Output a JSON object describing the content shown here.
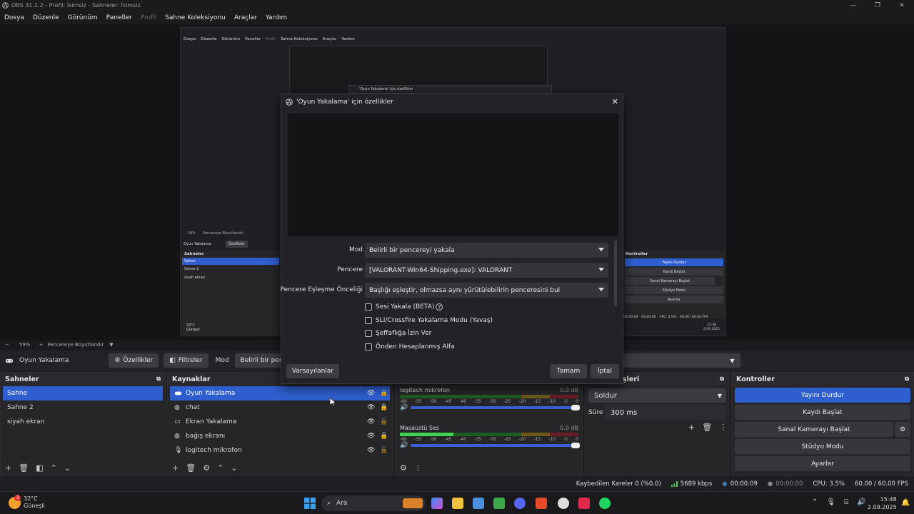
{
  "window": {
    "title": "OBS 31.1.2 - Profil: İsimsiz - Sahneler: İsimsiz"
  },
  "menu": {
    "items": [
      "Dosya",
      "Düzenle",
      "Görünüm",
      "Paneller",
      "Profil",
      "Sahne Koleksiyonu",
      "Araçlar",
      "Yardım"
    ],
    "disabled": [
      "Profil"
    ]
  },
  "nested": {
    "menu": [
      "Dosya",
      "Düzenle",
      "Görünüm",
      "Paneller",
      "Profil",
      "Sahne Koleksiyonu",
      "Araçlar",
      "Yardım"
    ],
    "inner_dialog_title": "'Oyun Yakalama' için özellikler",
    "zoom": "59%",
    "zoom_mode": "Pencereye Boyutlandır",
    "source_name": "Oyun Yakalama",
    "properties_label": "Özellikler",
    "scenes_header": "Sahneler",
    "scenes": [
      "Sahne",
      "Sahne 2",
      "siyah ekran"
    ],
    "controls_header": "Kontroller",
    "controls": [
      "Yayını Durdur",
      "Kaydı Başlat",
      "Sanal Kamerayı Başlat",
      "Stüdyo Modu",
      "Ayarlar"
    ],
    "status": {
      "timer": "00:00:09",
      "rec": "00:00:00",
      "cpu": "CPU: 3.5%",
      "fps": "60.00 / 60.00 FPS",
      "time": "15:48",
      "date": "2.09.2025"
    },
    "weather": {
      "temp": "32°C",
      "desc": "Güneşli"
    }
  },
  "zoombar": {
    "zoom": "59%",
    "mode": "Pencereye Boyutlandır"
  },
  "source_toolbar": {
    "source": "Oyun Yakalama",
    "properties": "Özellikler",
    "filters": "Filtreler",
    "mode_label": "Mod",
    "mode_value": "Belirli bir pencereyi yakala"
  },
  "dialog": {
    "title": "'Oyun Yakalama' için özellikler",
    "rows": [
      {
        "label": "Mod",
        "value": "Belirli bir pencereyi yakala"
      },
      {
        "label": "Pencere",
        "value": "[VALORANT-Win64-Shipping.exe]: VALORANT"
      },
      {
        "label": "Pencere Eşleşme Önceliği",
        "value": "Başlığı eşleştir, olmazsa aynı yürütülebilirin penceresini bul"
      }
    ],
    "checkboxes": [
      "Sesi Yakala (BETA)",
      "SLI/Crossfire Yakalama Modu (Yavaş)",
      "Şeffaflığa İzin Ver",
      "Önden Hesaplanmış Alfa"
    ],
    "defaults_button": "Varsayılanlar",
    "ok_button": "Tamam",
    "cancel_button": "İptal"
  },
  "scenes": {
    "header": "Sahneler",
    "items": [
      "Sahne",
      "Sahne 2",
      "siyah ekran"
    ],
    "selected": 0
  },
  "sources": {
    "header": "Kaynaklar",
    "items": [
      {
        "name": "Oyun Yakalama",
        "icon": "gamepad-icon",
        "locked": true
      },
      {
        "name": "chat",
        "icon": "globe-icon",
        "locked": true
      },
      {
        "name": "Ekran Yakalama",
        "icon": "monitor-icon",
        "locked": false
      },
      {
        "name": "bağış ekranı",
        "icon": "globe-icon",
        "locked": true
      },
      {
        "name": "logitech mikrofon",
        "icon": "microphone-icon",
        "locked": false
      }
    ]
  },
  "mixer": {
    "channels": [
      {
        "name": "logitech mikrofon",
        "db": "0.0 dB",
        "level": 0
      },
      {
        "name": "Masaüstü Ses",
        "db": "0.0 dB",
        "level": 0.3
      }
    ],
    "scale": [
      "-60",
      "-55",
      "-50",
      "-45",
      "-40",
      "-35",
      "-30",
      "-25",
      "-20",
      "-15",
      "-10",
      "-5",
      "0"
    ]
  },
  "transitions": {
    "header": "Sahne Geçişleri",
    "header_visible": "şleri",
    "type": "Soldur",
    "duration_label": "Süre",
    "duration": "300 ms"
  },
  "controls": {
    "header": "Kontroller",
    "buttons": [
      "Yayını Durdur",
      "Kaydı Başlat",
      "Sanal Kamerayı Başlat",
      "Stüdyo Modu",
      "Ayarlar"
    ]
  },
  "status": {
    "dropped": "Kaybedilen Kareler 0 (%0.0)",
    "bitrate": "5689 kbps",
    "stream_time": "00:00:09",
    "rec_time": "00:00:00",
    "cpu": "CPU: 3.5%",
    "fps": "60.00 / 60.00 FPS"
  },
  "taskbar": {
    "temp": "32°C",
    "weather": "Güneşli",
    "search": "Ara",
    "time": "15:48",
    "date": "2.09.2025",
    "badge": "3"
  },
  "colors": {
    "accent": "#2f5fcf",
    "bg": "#1f1f23"
  }
}
